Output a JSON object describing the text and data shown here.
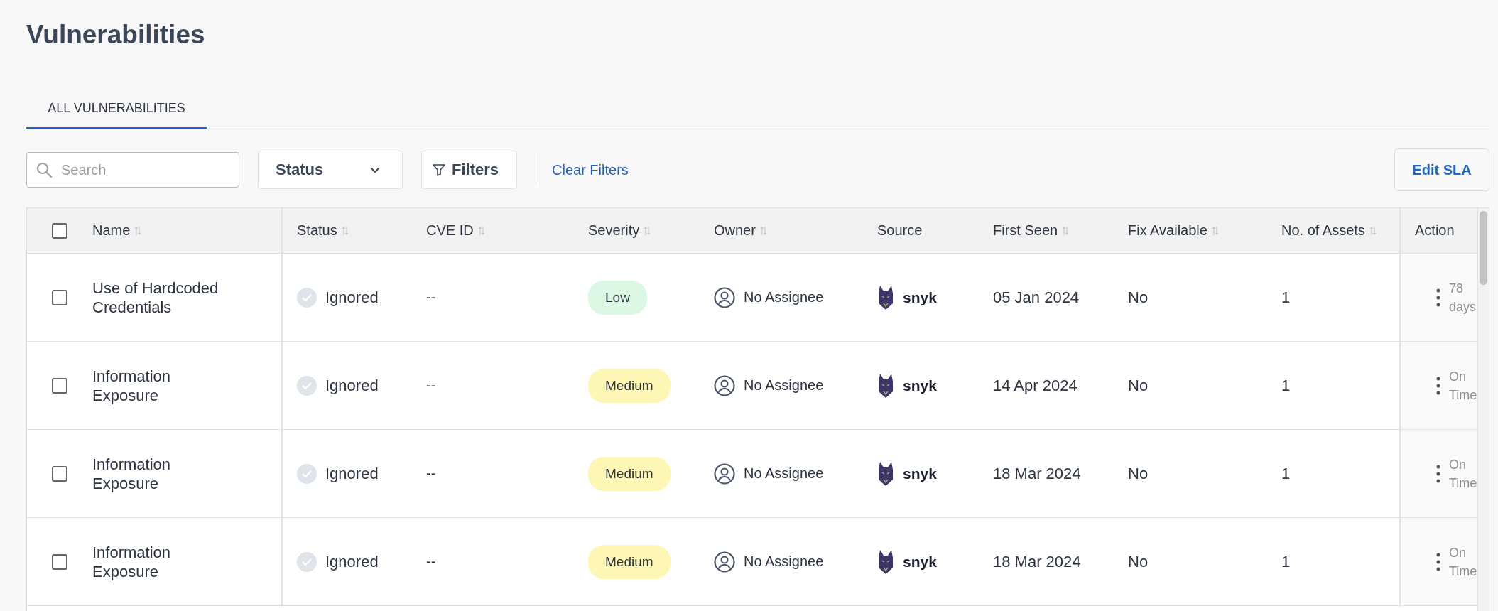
{
  "page": {
    "title": "Vulnerabilities"
  },
  "tabs": [
    {
      "label": "ALL VULNERABILITIES",
      "selected": true
    }
  ],
  "toolbar": {
    "search": {
      "placeholder": "Search"
    },
    "status_filter": "Status",
    "filters_button": "Filters",
    "clear_filters": "Clear Filters",
    "edit_sla": "Edit SLA"
  },
  "table": {
    "select_all": {
      "checked": false
    },
    "columns": [
      {
        "label": "Name",
        "sortable": true
      },
      {
        "label": "Status",
        "sortable": true
      },
      {
        "label": "CVE ID",
        "sortable": true
      },
      {
        "label": "Severity",
        "sortable": true
      },
      {
        "label": "Owner",
        "sortable": true
      },
      {
        "label": "Source",
        "sortable": false
      },
      {
        "label": "First Seen",
        "sortable": true
      },
      {
        "label": "Fix Available",
        "sortable": true
      },
      {
        "label": "No. of Assets",
        "sortable": true
      },
      {
        "label": "Action",
        "sortable": false
      }
    ],
    "rows": [
      {
        "checked": false,
        "name": "Use of Hardcoded Credentials",
        "status": "Ignored",
        "cve_id": "--",
        "severity": {
          "label": "Low",
          "color": "#dcf7e3"
        },
        "owner": "No Assignee",
        "source": "snyk",
        "first_seen": "05 Jan 2024",
        "fix_available": "No",
        "assets": "1",
        "sla": "78 days"
      },
      {
        "checked": false,
        "name": "Information Exposure",
        "status": "Ignored",
        "cve_id": "--",
        "severity": {
          "label": "Medium",
          "color": "#fdf6b4"
        },
        "owner": "No Assignee",
        "source": "snyk",
        "first_seen": "14 Apr 2024",
        "fix_available": "No",
        "assets": "1",
        "sla": "On Time"
      },
      {
        "checked": false,
        "name": "Information Exposure",
        "status": "Ignored",
        "cve_id": "--",
        "severity": {
          "label": "Medium",
          "color": "#fdf6b4"
        },
        "owner": "No Assignee",
        "source": "snyk",
        "first_seen": "18 Mar 2024",
        "fix_available": "No",
        "assets": "1",
        "sla": "On Time"
      },
      {
        "checked": false,
        "name": "Information Exposure",
        "status": "Ignored",
        "cve_id": "--",
        "severity": {
          "label": "Medium",
          "color": "#fdf6b4"
        },
        "owner": "No Assignee",
        "source": "snyk",
        "first_seen": "18 Mar 2024",
        "fix_available": "No",
        "assets": "1",
        "sla": "On Time"
      }
    ]
  }
}
